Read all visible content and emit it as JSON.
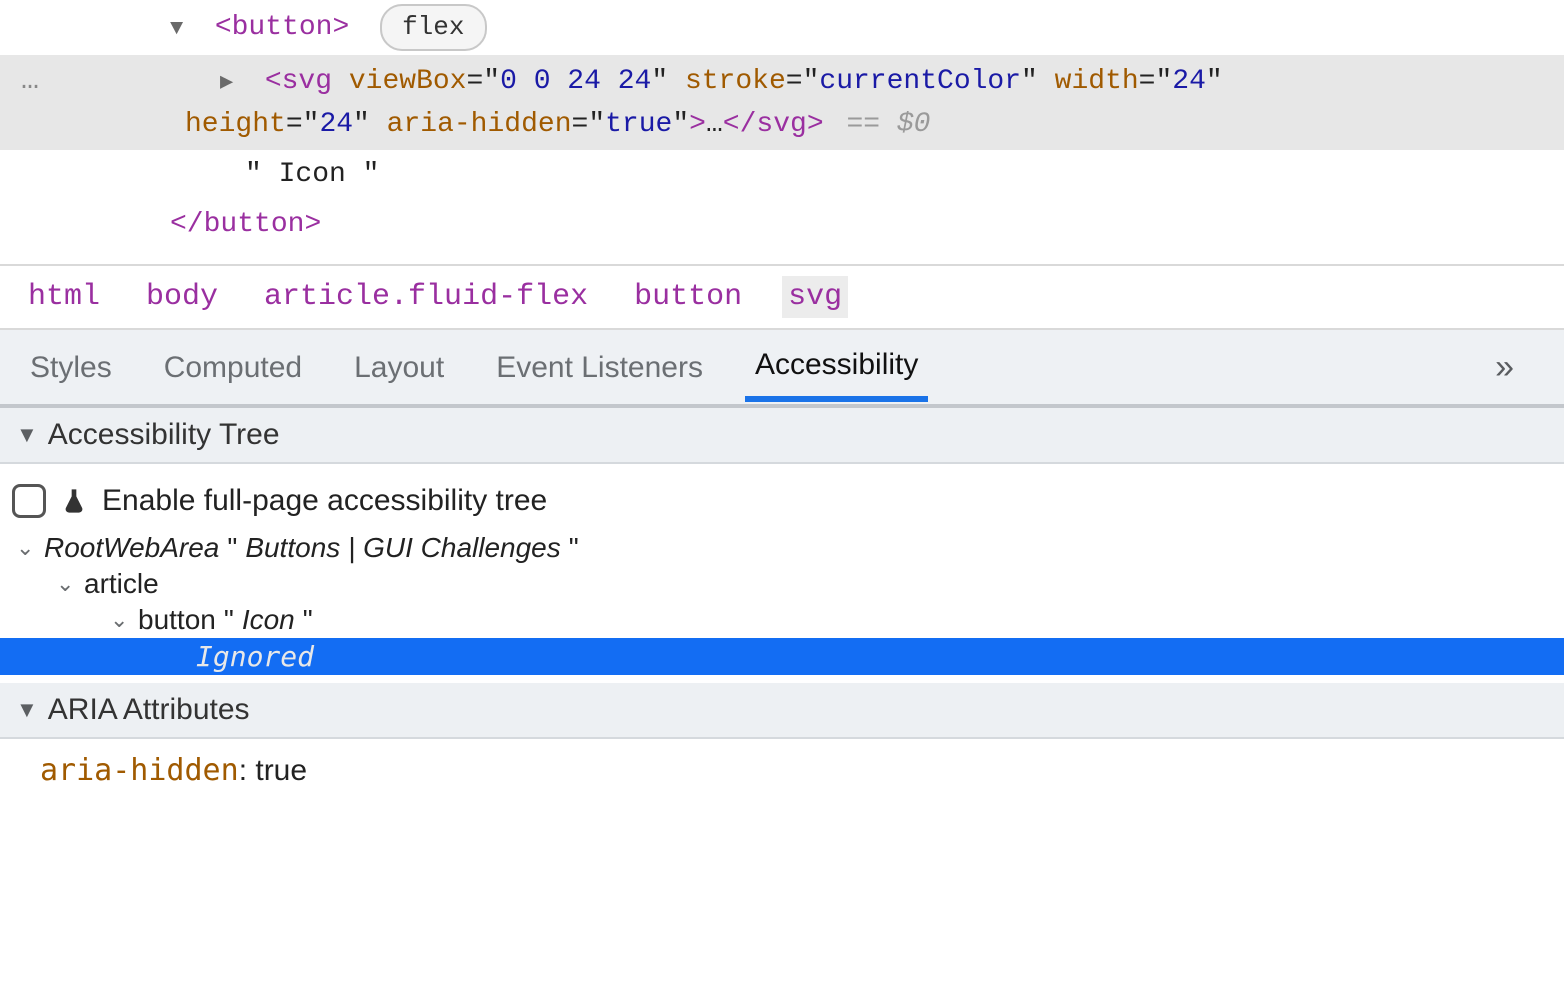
{
  "dom": {
    "button_open": {
      "tag": "button",
      "badge": "flex"
    },
    "svg": {
      "tag": "svg",
      "attrs": [
        {
          "name": "viewBox",
          "value": "0 0 24 24"
        },
        {
          "name": "stroke",
          "value": "currentColor"
        },
        {
          "name": "width",
          "value": "24"
        },
        {
          "name": "height",
          "value": "24"
        },
        {
          "name": "aria-hidden",
          "value": "true"
        }
      ],
      "ellipsis": "…",
      "close_tag": "svg",
      "eq_ref": "== $0"
    },
    "text_node": "\" Icon \"",
    "button_close": "button",
    "gutter_dots": "…"
  },
  "breadcrumb": [
    "html",
    "body",
    "article.fluid-flex",
    "button",
    "svg"
  ],
  "tabs": {
    "items": [
      "Styles",
      "Computed",
      "Layout",
      "Event Listeners",
      "Accessibility"
    ],
    "active_index": 4,
    "more_glyph": "»"
  },
  "a11y": {
    "tree_section_title": "Accessibility Tree",
    "enable_label": "Enable full-page accessibility tree",
    "tree": {
      "root": {
        "role": "RootWebArea",
        "name": "Buttons | GUI Challenges"
      },
      "l1": {
        "role": "article"
      },
      "l2": {
        "role": "button",
        "name": "Icon"
      },
      "l3": {
        "label": "Ignored"
      }
    },
    "aria_section_title": "ARIA Attributes",
    "aria_attr": {
      "key": "aria-hidden",
      "value": "true"
    }
  }
}
